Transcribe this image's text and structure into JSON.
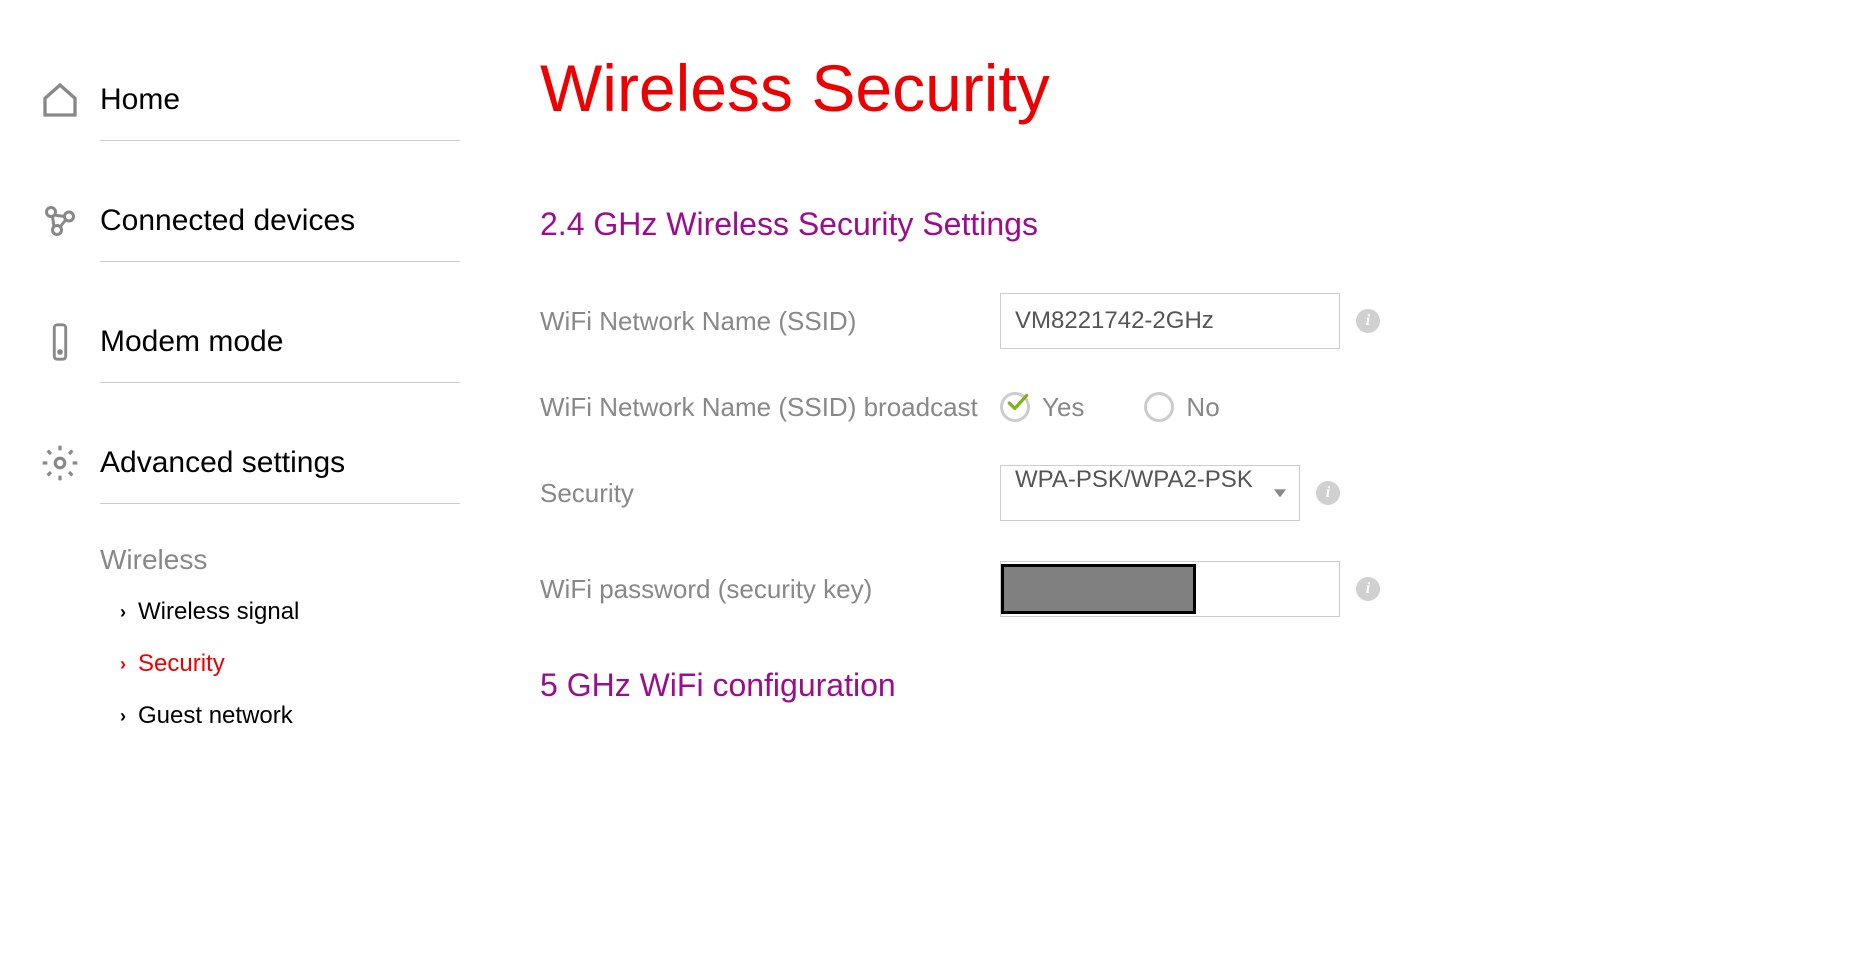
{
  "nav": {
    "home": "Home",
    "connected_devices": "Connected devices",
    "modem_mode": "Modem mode",
    "advanced_settings": "Advanced settings"
  },
  "subnav": {
    "header": "Wireless",
    "items": [
      {
        "label": "Wireless signal",
        "active": false
      },
      {
        "label": "Security",
        "active": true
      },
      {
        "label": "Guest network",
        "active": false
      }
    ]
  },
  "page_title": "Wireless Security",
  "section_24": {
    "title": "2.4 GHz Wireless Security Settings",
    "ssid_label": "WiFi Network Name (SSID)",
    "ssid_value": "VM8221742-2GHz",
    "broadcast_label": "WiFi Network Name (SSID) broadcast",
    "broadcast_yes": "Yes",
    "broadcast_no": "No",
    "security_label": "Security",
    "security_value": "WPA-PSK/WPA2-PSK",
    "password_label": "WiFi password (security key)"
  },
  "section_5": {
    "title": "5 GHz WiFi configuration"
  }
}
